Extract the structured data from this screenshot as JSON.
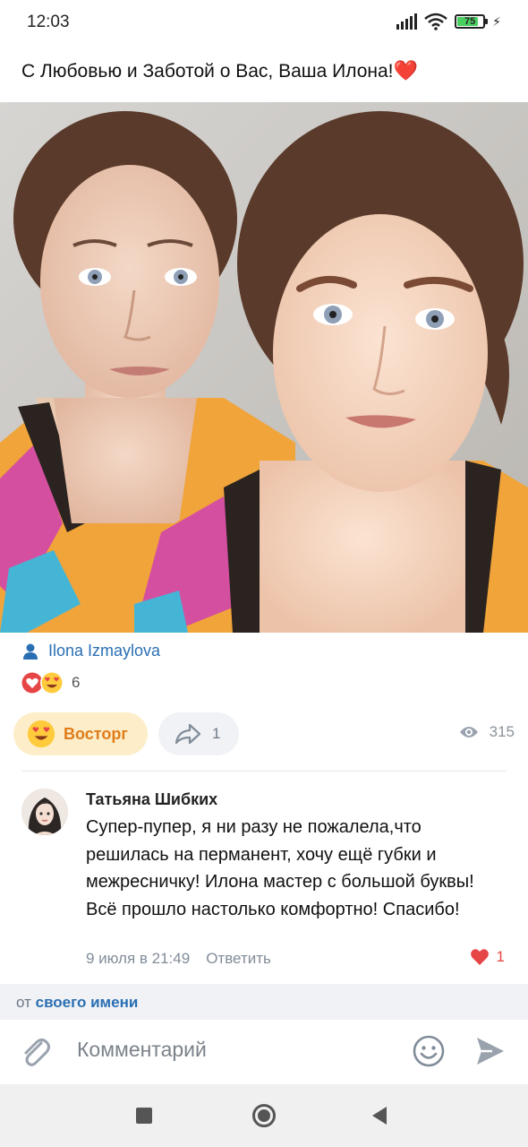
{
  "status_bar": {
    "time": "12:03",
    "battery_level": "75",
    "battery_fraction": 0.75
  },
  "post": {
    "text": "С Любовью и Заботой о Вас, Ваша Илона!",
    "text_emoji": "❤️",
    "photo_alt": "",
    "author": "Ilona Izmaylova",
    "reactions_count": "6",
    "reaction_button_label": "Восторг",
    "shares_count": "1",
    "views_count": "315"
  },
  "comment": {
    "author": "Татьяна Шибких",
    "text": "Супер-пупер, я ни разу не пожалела,что решилась на перманент, хочу ещё губки и межресничку! Илона мастер с большой буквы! Всё прошло настолько комфортно! Спасибо!",
    "date": "9 июля в 21:49",
    "reply_label": "Ответить",
    "likes_count": "1"
  },
  "composer": {
    "reply_as_prefix": "от",
    "reply_as_link": "своего имени",
    "placeholder": "Комментарий"
  },
  "colors": {
    "link": "#2a6fb3",
    "accent_orange": "#e07c1a",
    "like_red": "#e64646"
  },
  "icons": {
    "author": "person-icon",
    "reactions": [
      "heart-reaction-icon",
      "heart-eyes-emoji-icon"
    ],
    "share": "share-arrow-icon",
    "views": "eye-icon",
    "attach": "paperclip-icon",
    "emoji": "smiley-icon",
    "send": "send-icon"
  }
}
